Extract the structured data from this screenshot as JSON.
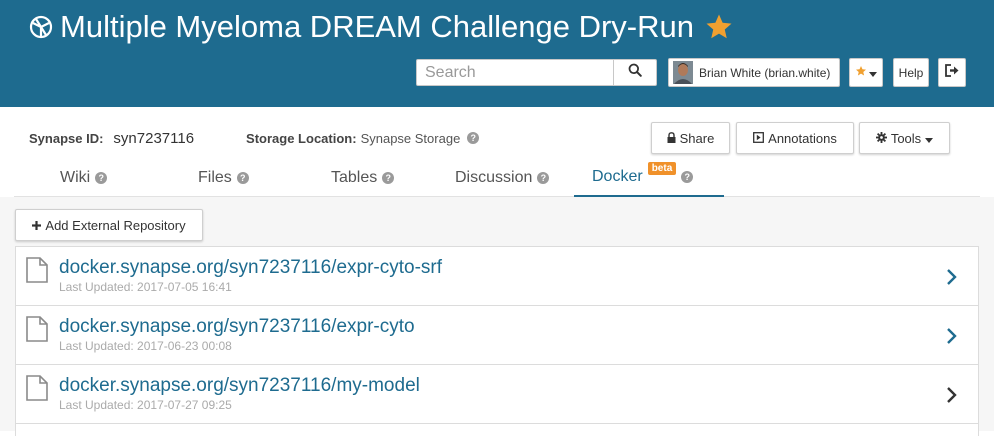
{
  "header": {
    "project_title": "Multiple Myeloma DREAM Challenge Dry-Run",
    "search_placeholder": "Search",
    "user_label": "Brian White (brian.white)",
    "help_label": "Help",
    "colors": {
      "header_bg": "#1e6b8f",
      "star": "#f0a030"
    }
  },
  "meta": {
    "synapse_id_label": "Synapse ID:",
    "synapse_id_value": "syn7237116",
    "storage_label": "Storage Location:",
    "storage_value": "Synapse Storage"
  },
  "actions": {
    "share_label": "Share",
    "annotations_label": "Annotations",
    "tools_label": "Tools"
  },
  "tabs": [
    {
      "label": "Wiki",
      "active": false
    },
    {
      "label": "Files",
      "active": false
    },
    {
      "label": "Tables",
      "active": false
    },
    {
      "label": "Discussion",
      "active": false
    },
    {
      "label": "Docker",
      "active": true,
      "badge": "beta"
    }
  ],
  "docker": {
    "add_repo_label": "Add External Repository",
    "repositories": [
      {
        "name": "docker.synapse.org/syn7237116/expr-cyto-srf",
        "updated": "Last Updated: 2017-07-05 16:41"
      },
      {
        "name": "docker.synapse.org/syn7237116/expr-cyto",
        "updated": "Last Updated: 2017-06-23 00:08"
      },
      {
        "name": "docker.synapse.org/syn7237116/my-model",
        "updated": "Last Updated: 2017-07-27 09:25"
      }
    ]
  }
}
